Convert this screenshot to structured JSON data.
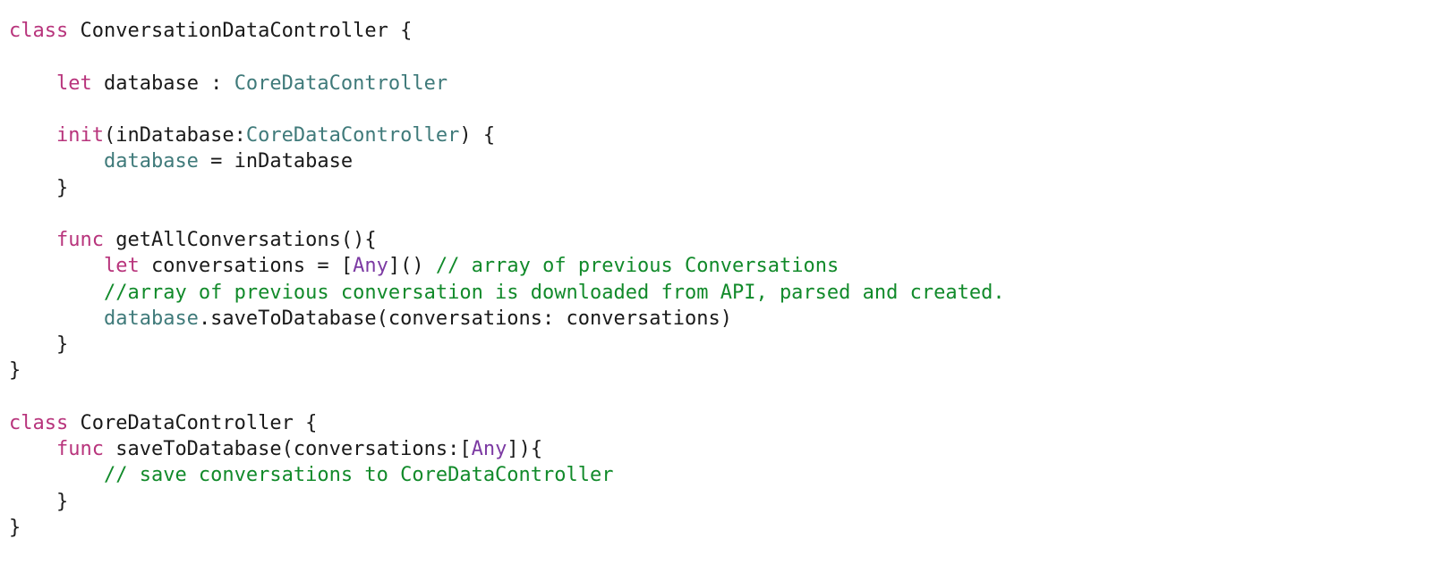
{
  "colors": {
    "keyword": "#b8347c",
    "type": "#3f7a7a",
    "stdtype": "#7c3aa3",
    "comment": "#118a2a",
    "default": "#1a1a1a",
    "background": "#ffffff"
  },
  "t": {
    "l1_kw_class": "class",
    "l1_name": " ConversationDataController {",
    "blank": "",
    "l3_kw_let": "let",
    "l3_var": " database : ",
    "l3_type": "CoreDataController",
    "l5_kw_init": "init",
    "l5_sig_a": "(inDatabase:",
    "l5_sig_type": "CoreDataController",
    "l5_sig_b": ") {",
    "l6_lhs": "database",
    "l6_rest": " = inDatabase",
    "l7_brace": "}",
    "l9_kw_func": "func",
    "l9_sig": " getAllConversations(){",
    "l10_kw_let": "let",
    "l10_a": " conversations = [",
    "l10_any": "Any",
    "l10_b": "]() ",
    "l10_comment": "// array of previous Conversations",
    "l11_comment": "//array of previous conversation is downloaded from API, parsed and created.",
    "l12_recv": "database",
    "l12_call": ".saveToDatabase(conversations: conversations)",
    "l13_brace": "}",
    "l14_brace": "}",
    "l16_kw_class": "class",
    "l16_name": " CoreDataController {",
    "l17_kw_func": "func",
    "l17_sig_a": " saveToDatabase(conversations:[",
    "l17_any": "Any",
    "l17_sig_b": "]){",
    "l18_comment": "// save conversations to CoreDataController",
    "l19_brace": "}",
    "l20_brace": "}"
  }
}
